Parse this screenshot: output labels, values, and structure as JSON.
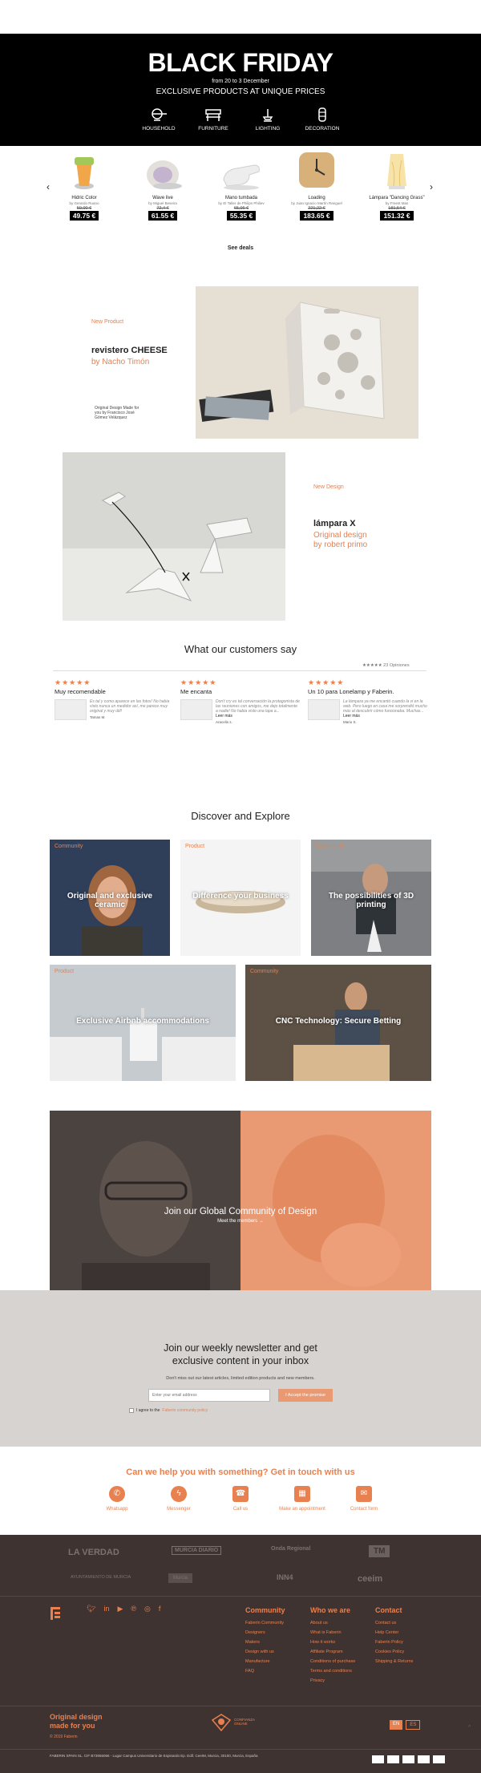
{
  "black_friday": {
    "title": "BLACK FRIDAY",
    "dates": "from 20 to 3 December",
    "subtitle": "EXCLUSIVE PRODUCTS AT UNIQUE PRICES",
    "categories": [
      "HOUSEHOLD",
      "FURNITURE",
      "LIGHTING",
      "DECORATION"
    ]
  },
  "carousel": {
    "prev": "‹",
    "next": "›",
    "products": [
      {
        "name": "Hidric Color",
        "by": "by Gerardo Ruano",
        "old": "59,00 €",
        "new": "49.75 €"
      },
      {
        "name": "Wave live",
        "by": "by Miguel Beseira",
        "old": "72,4 €",
        "new": "61.55 €"
      },
      {
        "name": "Mano tumbada",
        "by": "by El Taller de Philips Philiev",
        "old": "65,06 €",
        "new": "55.35 €"
      },
      {
        "name": "Loading",
        "by": "by Juan Ignacio Martín Ranguel",
        "old": "221,22 €",
        "new": "183.65 €"
      },
      {
        "name": "Lámpara \"Dancing Grass\"",
        "by": "by Freest Mas",
        "old": "181,54 €",
        "new": "151.32 €"
      }
    ],
    "see_deals": "See deals"
  },
  "feature1": {
    "tag": "New Product",
    "title": "revistero CHEESE",
    "by": "by Nacho Timón",
    "note": "Original Design Made for you by Francisco José Gómez Velázquez"
  },
  "feature2": {
    "tag": "New Design",
    "title": "lámpara X",
    "line1": "Original design",
    "line2": "by robert primo"
  },
  "reviews": {
    "heading": "What our customers say",
    "count": "★★★★★ 23 Opiniones",
    "items": [
      {
        "stars": "★★★★★",
        "title": "Muy recomendable",
        "text": "Es tal y como aparece en las fotos! No habia visto nunca un medidor así, me parece muy original y muy útil!",
        "author": "Tamas M.",
        "more": ""
      },
      {
        "stars": "★★★★★",
        "title": "Me encanta",
        "text": "Don't cry es tal conversación la protagonista de las reuniones con amigos, me dejo totalmente a nadie! No habia visto una lapa a...",
        "author": "Aracelis s.",
        "more": "Leer más"
      },
      {
        "stars": "★★★★★",
        "title": "Un 10 para Lonelamp y Faberin.",
        "text": "La lámpara ya me encantó cuando la vi en la web. Pero luego en casa me sorprendió mucho más al descubrir cómo funcionaba. Muchas...",
        "author": "Mario S.",
        "more": "Leer más"
      }
    ]
  },
  "discover": {
    "heading": "Discover and Explore",
    "cards": [
      {
        "tag": "Community",
        "title": "Original and exclusive ceramic"
      },
      {
        "tag": "Product",
        "title": "Difference your business"
      },
      {
        "tag": "Community",
        "title": "The possibilities of 3D printing"
      },
      {
        "tag": "Product",
        "title": "Exclusive Airbnb accommodations"
      },
      {
        "tag": "Community",
        "title": "CNC Technology: Secure Betting"
      }
    ]
  },
  "community": {
    "title": "Join our Global Community of Design",
    "link": "Meet the members →"
  },
  "newsletter": {
    "title_line1": "Join our weekly newsletter and get",
    "title_line2": "exclusive content in your inbox",
    "desc": "Don't miss out our latest articles, limited edition products and new members.",
    "placeholder": "Enter your email address",
    "button": "I Accept the promise",
    "consent_prefix": "I agree to the",
    "consent_link": "Faberin community policy"
  },
  "help": {
    "heading": "Can we help you with something? Get in touch with us",
    "items": [
      "Whatsapp",
      "Messenger",
      "Call us",
      "Make an appointment",
      "Contact form"
    ]
  },
  "press": [
    "LA VERDAD",
    "MURCIA DIARIO",
    "Onda Regional",
    "TM",
    "AYUNTAMIENTO DE MURCIA",
    "Murcia",
    "INN4",
    "ceeim"
  ],
  "footer": {
    "community": {
      "heading": "Community",
      "links": [
        "Faberin Community",
        "Designers",
        "Makers",
        "Design with us",
        "Manufacture",
        "FAQ"
      ]
    },
    "who": {
      "heading": "Who we are",
      "links": [
        "About us",
        "What is Faberin",
        "How it works",
        "Affiliate Program",
        "Conditions of purchase",
        "Terms and conditions",
        "Privacy"
      ]
    },
    "contact": {
      "heading": "Contact",
      "links": [
        "Contact us",
        "Help Center",
        "Faberin Policy",
        "Cookies Policy",
        "Shipping & Returns"
      ]
    },
    "tagline_1": "Original design",
    "tagline_2": "made for you",
    "copyright": "© 2019 Faberin",
    "address": "FABERIN SPAIN SL. CIF B73956066 - Lugar Campus Universitario de Espinardo Ep. Edif. CeeIM, Murcia, 30100, Murcia, España",
    "lang": [
      "EN",
      "ES"
    ],
    "badge": "CONFIANZA ONLINE"
  },
  "colors": {
    "accent": "#e8804f",
    "dark": "#3f3331",
    "black": "#000000"
  }
}
